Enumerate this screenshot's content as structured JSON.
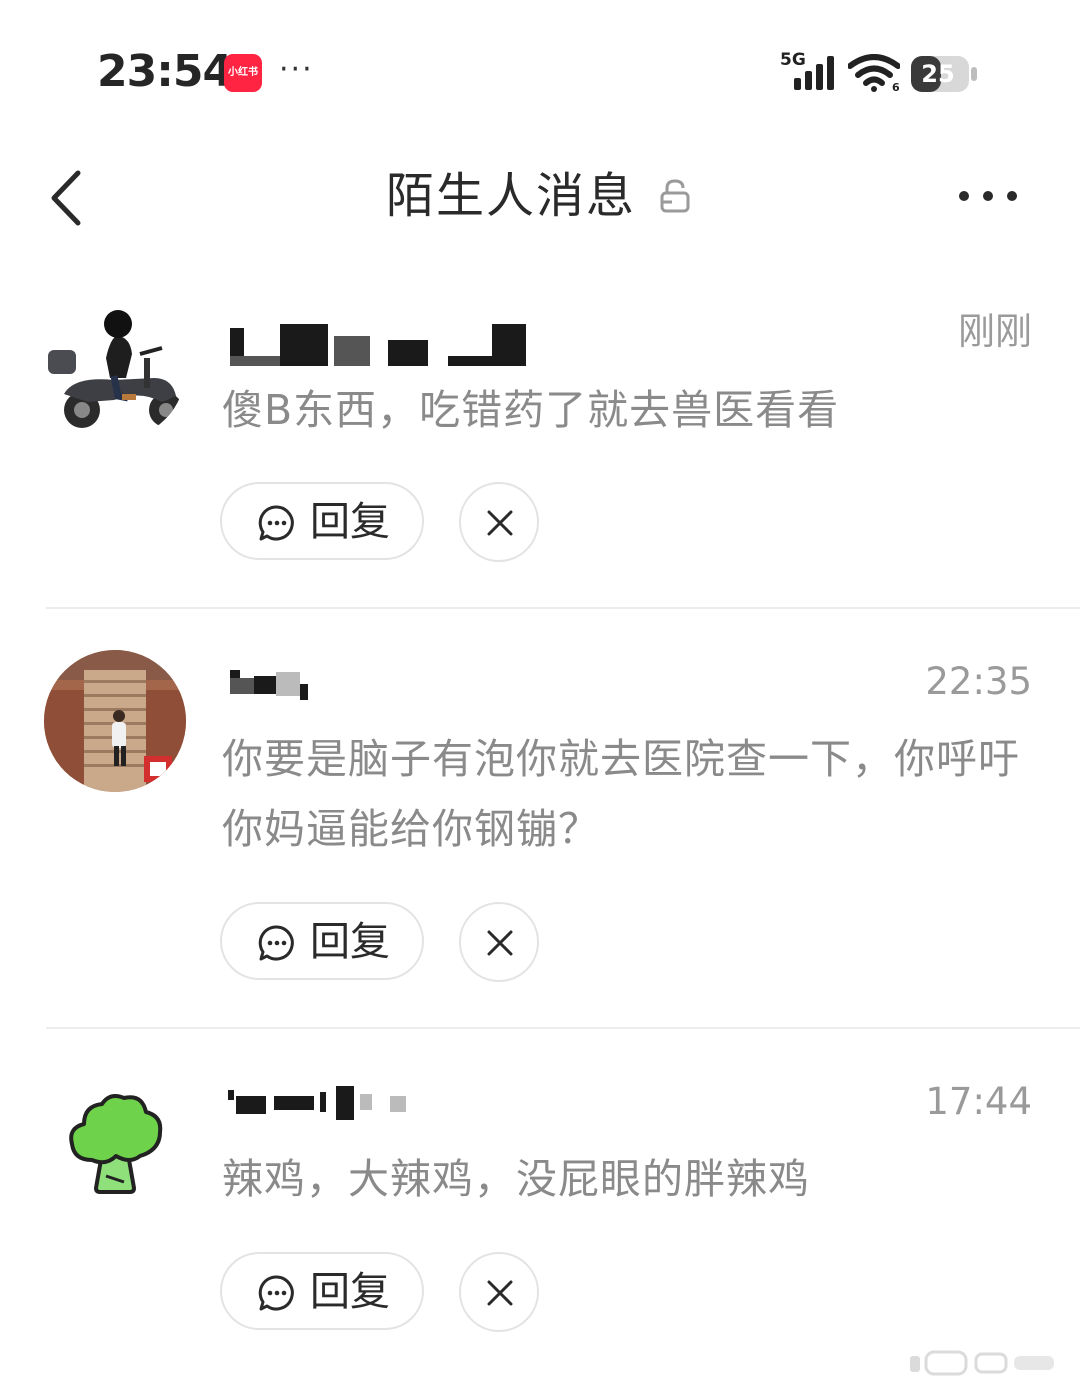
{
  "status_bar": {
    "time": "23:54",
    "app_badge": "小红书",
    "more": "···",
    "network": "5G",
    "battery": "25"
  },
  "header": {
    "title": "陌生人消息"
  },
  "messages": [
    {
      "time": "刚刚",
      "content": "傻B东西，吃错药了就去兽医看看",
      "reply_label": "回复"
    },
    {
      "time": "22:35",
      "content": "你要是脑子有泡你就去医院查一下，你呼吁你妈逼能给你钢镚？",
      "reply_label": "回复"
    },
    {
      "time": "17:44",
      "content": "辣鸡，大辣鸡，没屁眼的胖辣鸡",
      "reply_label": "回复"
    }
  ],
  "colors": {
    "brand_red": "#ff2442",
    "time_grey": "#9a9a9a",
    "content_grey": "#8a8a8a",
    "divider": "#ececec"
  },
  "icons": {
    "back": "chevron-left-icon",
    "lock": "lock-icon",
    "more": "more-horizontal-icon",
    "reply": "chat-bubble-icon",
    "dismiss": "close-icon"
  }
}
